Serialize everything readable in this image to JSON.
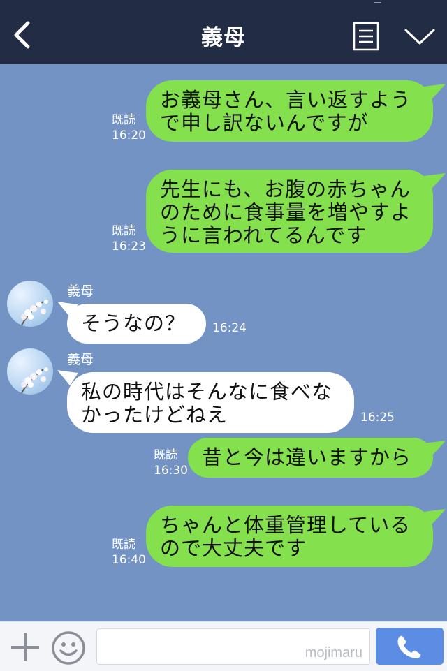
{
  "header": {
    "title": "義母",
    "back_icon": "chevron-left-icon",
    "notes_icon": "notes-icon",
    "menu_icon": "chevron-down-icon"
  },
  "messages": [
    {
      "from": "me",
      "lines": [
        "お義母さん、言い返すよう",
        "で申し訳ないんですが"
      ],
      "read": "既読",
      "time": "16:20"
    },
    {
      "from": "me",
      "lines": [
        "先生にも、お腹の赤ちゃん",
        "のために食事量を増やすよ",
        "うに言われてるんです"
      ],
      "read": "既読",
      "time": "16:23"
    },
    {
      "from": "them",
      "sender": "義母",
      "lines": [
        "そうなの？"
      ],
      "time": "16:24"
    },
    {
      "from": "them",
      "sender": "義母",
      "lines": [
        "私の時代はそんなに食べな",
        "かったけどねえ"
      ],
      "time": "16:25"
    },
    {
      "from": "me",
      "lines": [
        "昔と今は違いますから"
      ],
      "read": "既読",
      "time": "16:30"
    },
    {
      "from": "me",
      "lines": [
        "ちゃんと体重管理している",
        "ので大丈夫です"
      ],
      "read": "既読",
      "time": "16:40"
    }
  ],
  "input": {
    "placeholder": "",
    "watermark": "mojimaru"
  },
  "colors": {
    "header_bg": "#222d45",
    "chat_bg": "#7393c5",
    "my_bubble": "#84e04c",
    "their_bubble": "#ffffff",
    "call_button": "#5b8de5"
  }
}
